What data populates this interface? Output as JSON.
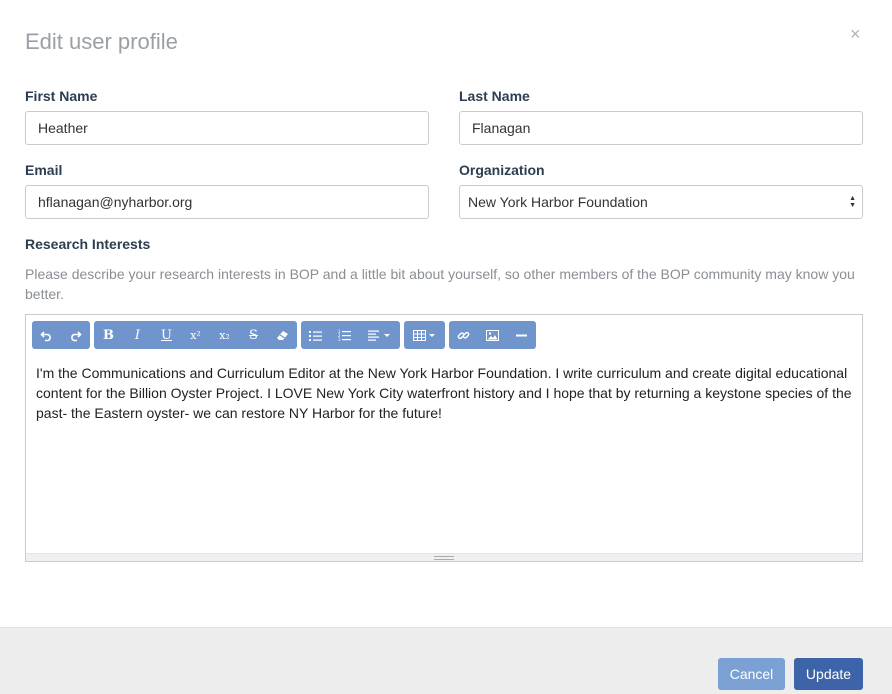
{
  "modal": {
    "title": "Edit user profile",
    "close_label": "×"
  },
  "form": {
    "first_name": {
      "label": "First Name",
      "value": "Heather"
    },
    "last_name": {
      "label": "Last Name",
      "value": "Flanagan"
    },
    "email": {
      "label": "Email",
      "value": "hflanagan@nyharbor.org"
    },
    "organization": {
      "label": "Organization",
      "value": "New York Harbor Foundation"
    },
    "research": {
      "label": "Research Interests",
      "help": "Please describe your research interests in BOP and a little bit about yourself, so other members of the BOP community may know you better.",
      "content": "I'm the Communications and Curriculum Editor at the New York Harbor Foundation.  I write curriculum and create digital educational content for the Billion Oyster Project.  I LOVE New York City waterfront history and I hope that by returning a keystone species of the past- the Eastern oyster- we can restore NY Harbor for the future!"
    }
  },
  "toolbar": {
    "groups": [
      [
        "undo-icon",
        "redo-icon"
      ],
      [
        "bold-icon",
        "italic-icon",
        "underline-icon",
        "superscript-icon",
        "subscript-icon",
        "strikethrough-icon",
        "eraser-icon"
      ],
      [
        "bullet-list-icon",
        "numbered-list-icon",
        "align-dropdown-icon"
      ],
      [
        "table-dropdown-icon"
      ],
      [
        "link-icon",
        "image-icon",
        "horizontal-rule-icon"
      ]
    ],
    "glyphs": {
      "bold": "B",
      "italic": "I",
      "underline": "U",
      "superscript": "x²",
      "subscript": "x₂",
      "strikethrough": "S"
    }
  },
  "footer": {
    "cancel_label": "Cancel",
    "update_label": "Update"
  },
  "colors": {
    "toolbar": "#6f95cc",
    "cancel": "#7aa0d4",
    "update": "#3d64a8"
  }
}
